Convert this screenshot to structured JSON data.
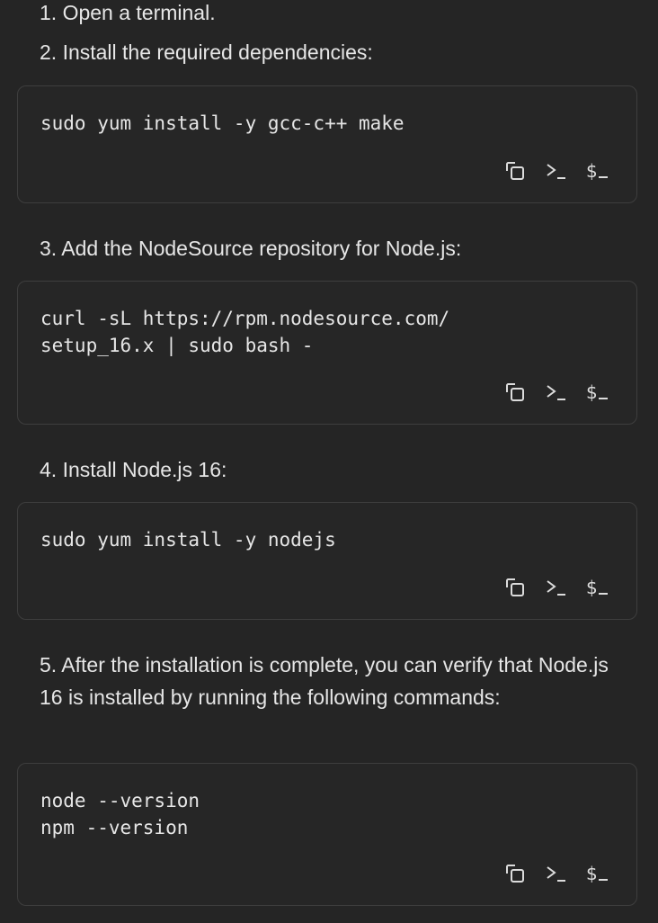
{
  "steps": [
    {
      "text": "1. Open a terminal."
    },
    {
      "text": "2. Install the required dependencies:",
      "code": "sudo yum install -y gcc-c++ make"
    },
    {
      "text": "3. Add the NodeSource repository for Node.js:",
      "code": "curl -sL https://rpm.nodesource.com/\nsetup_16.x | sudo bash -"
    },
    {
      "text": "4. Install Node.js 16:",
      "code": "sudo yum install -y nodejs"
    },
    {
      "text": "5. After the installation is complete, you can verify that Node.js 16 is installed by running the following commands:",
      "code": "node --version\nnpm --version"
    }
  ],
  "code_actions": [
    {
      "icon": "copy-icon"
    },
    {
      "icon": "terminal-prompt-icon"
    },
    {
      "icon": "shell-dollar-icon"
    }
  ],
  "colors": {
    "background": "#252525",
    "text": "#e6e6e6",
    "border": "#3e3e3e"
  }
}
